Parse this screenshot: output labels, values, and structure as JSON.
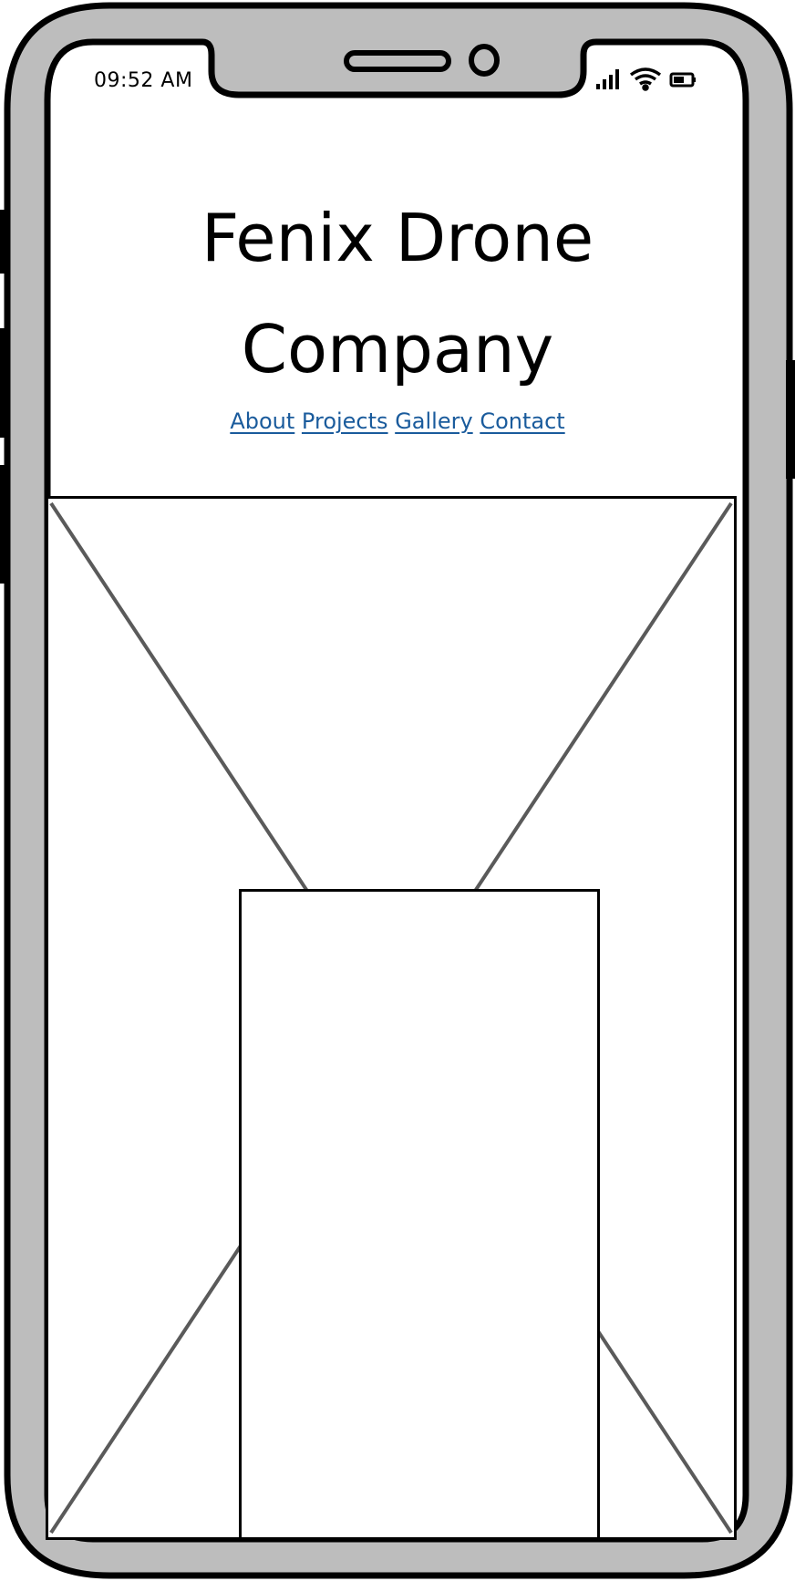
{
  "status_bar": {
    "time": "09:52 AM",
    "icons": [
      "signal-icon",
      "wifi-icon",
      "battery-icon"
    ]
  },
  "header": {
    "title": "Fenix Drone Company"
  },
  "nav": {
    "items": [
      {
        "label": "About"
      },
      {
        "label": "Projects"
      },
      {
        "label": "Gallery"
      },
      {
        "label": "Contact"
      }
    ]
  },
  "colors": {
    "link": "#1a5b9c",
    "frame": "#bdbdbd",
    "outline": "#000000",
    "placeholder_lines": "#5a5a5a"
  }
}
